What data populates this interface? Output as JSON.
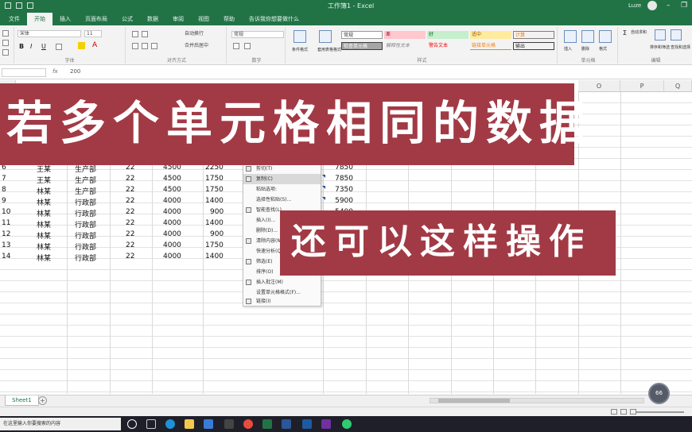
{
  "titlebar": {
    "document": "工作簿1 - Excel",
    "user": "Luze"
  },
  "tabs": [
    "文件",
    "开始",
    "插入",
    "页面布局",
    "公式",
    "数据",
    "审阅",
    "视图",
    "帮助",
    "告诉我你想要做什么"
  ],
  "ribbon": {
    "font_name": "宋体",
    "font_size": "11",
    "groups": [
      "剪贴板",
      "字体",
      "对齐方式",
      "数字",
      "样式",
      "单元格",
      "编辑"
    ],
    "number_format": "常规",
    "wrap": "自动换行",
    "merge": "合并后居中",
    "styles": {
      "row1": [
        "常规",
        "差",
        "好",
        "适中",
        "计算"
      ],
      "row2": [
        "检查单元格",
        "解释性文本",
        "警告文本",
        "链接单元格",
        "输出"
      ]
    },
    "conditional": "条件格式",
    "table_format": "套用表格格式",
    "insert": "插入",
    "delete": "删除",
    "format": "格式",
    "autosum": "自动求和",
    "sort": "排序和筛选",
    "find": "查找和选择"
  },
  "formula_bar": {
    "fx": "fx",
    "value": "200"
  },
  "columns": [
    "A",
    "B",
    "C",
    "D",
    "E",
    "F",
    "G",
    "H",
    "I",
    "J",
    "K",
    "L",
    "M",
    "N",
    "O",
    "P",
    "Q"
  ],
  "rows": [
    {
      "num": "6",
      "name": "王某",
      "dept": "生产部",
      "d": "22",
      "e": "4500",
      "f": "2250"
    },
    {
      "num": "7",
      "name": "王某",
      "dept": "生产部",
      "d": "22",
      "e": "4500",
      "f": "1750"
    },
    {
      "num": "8",
      "name": "林某",
      "dept": "生产部",
      "d": "22",
      "e": "4500",
      "f": "1750"
    },
    {
      "num": "9",
      "name": "林某",
      "dept": "行政部",
      "d": "22",
      "e": "4000",
      "f": "1400"
    },
    {
      "num": "10",
      "name": "林某",
      "dept": "行政部",
      "d": "22",
      "e": "4000",
      "f": "900"
    },
    {
      "num": "11",
      "name": "林某",
      "dept": "行政部",
      "d": "22",
      "e": "4000",
      "f": "1400"
    },
    {
      "num": "12",
      "name": "林某",
      "dept": "行政部",
      "d": "22",
      "e": "4000",
      "f": "900"
    },
    {
      "num": "13",
      "name": "林某",
      "dept": "行政部",
      "d": "22",
      "e": "4000",
      "f": "1750"
    },
    {
      "num": "14",
      "name": "林某",
      "dept": "行政部",
      "d": "22",
      "e": "4000",
      "f": "1400"
    }
  ],
  "right_column_values": [
    "7850",
    "7850",
    "7350",
    "5900",
    "5400"
  ],
  "context_menu": [
    "剪切(T)",
    "复制(C)",
    "粘贴选项:",
    "选择性粘贴(S)...",
    "智能查找(L)",
    "插入(I)...",
    "删除(D)...",
    "清除内容(N)",
    "快速分析(Q)",
    "筛选(E)",
    "排序(O)",
    "插入批注(M)",
    "设置单元格格式(F)...",
    "从下拉列表中选择(K)...",
    "显示拼音字段(S)",
    "定义名称(A)...",
    "链接(I)"
  ],
  "banners": {
    "top": "若多个单元格相同的数据",
    "bottom": "还可以这样操作"
  },
  "sheet_tab": "Sheet1",
  "bubble_label": "66",
  "taskbar_search": "在这里输入你要搜索的内容",
  "colors": {
    "excel_green": "#217346",
    "banner_red": "#a23a45"
  }
}
